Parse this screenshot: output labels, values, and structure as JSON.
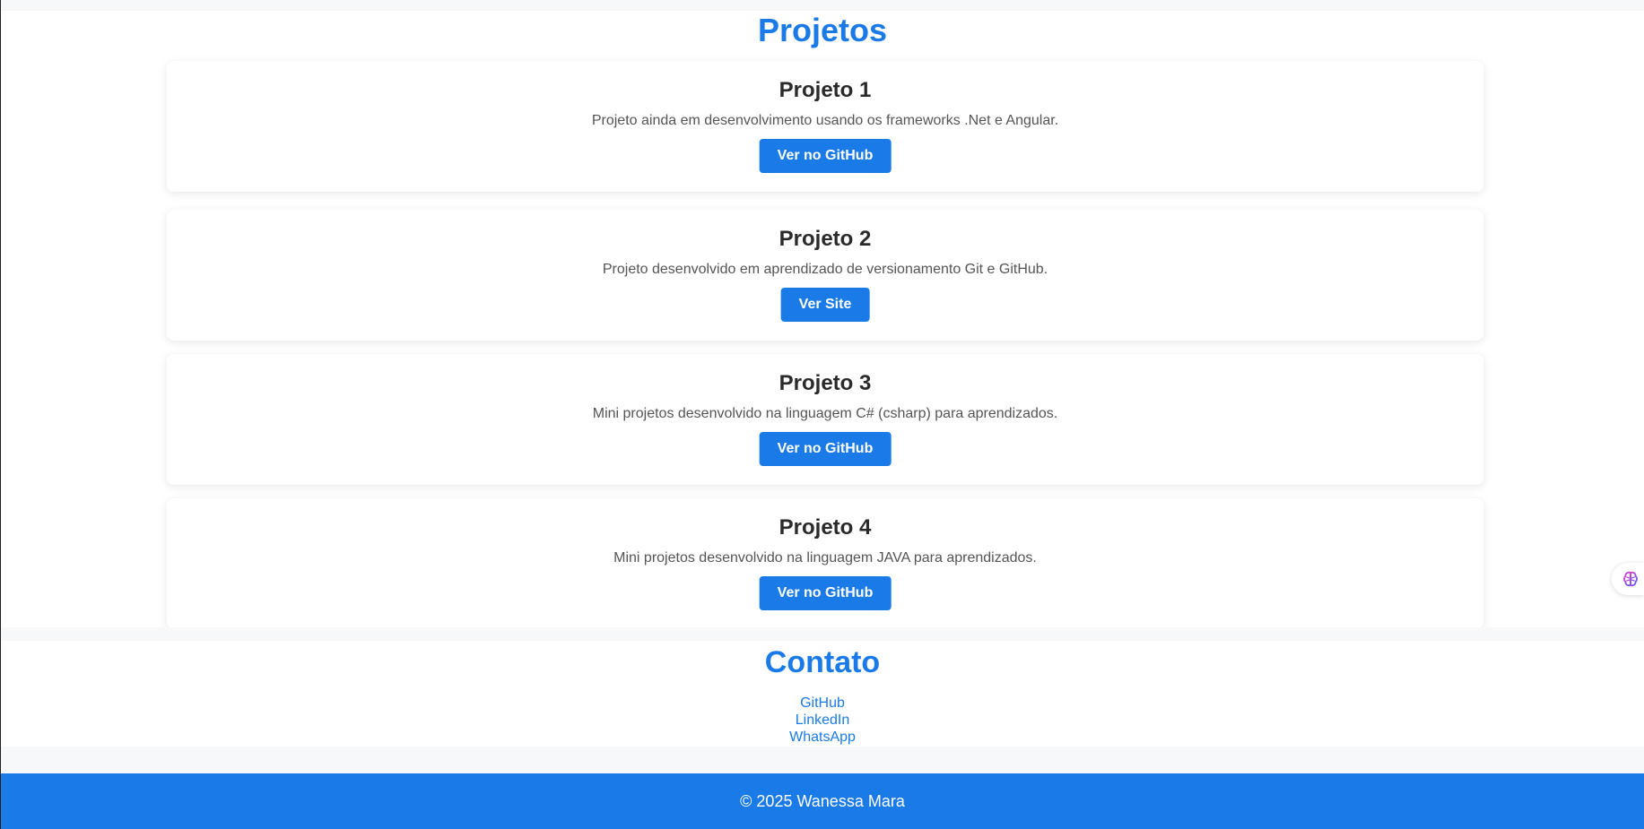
{
  "projects": {
    "title": "Projetos",
    "items": [
      {
        "title": "Projeto 1",
        "description": "Projeto ainda em desenvolvimento usando os frameworks .Net e Angular.",
        "button_label": "Ver no GitHub"
      },
      {
        "title": "Projeto 2",
        "description": "Projeto desenvolvido em aprendizado de versionamento Git e GitHub.",
        "button_label": "Ver Site"
      },
      {
        "title": "Projeto 3",
        "description": "Mini projetos desenvolvido na linguagem C# (csharp) para aprendizados.",
        "button_label": "Ver no GitHub"
      },
      {
        "title": "Projeto 4",
        "description": "Mini projetos desenvolvido na linguagem JAVA para aprendizados.",
        "button_label": "Ver no GitHub"
      }
    ]
  },
  "contact": {
    "title": "Contato",
    "links": [
      {
        "label": "GitHub"
      },
      {
        "label": "LinkedIn"
      },
      {
        "label": "WhatsApp"
      }
    ]
  },
  "footer": {
    "text": "© 2025 Wanessa Mara"
  },
  "extension_widget": {
    "icon": "brain-icon"
  },
  "colors": {
    "accent": "#1a7ae8",
    "heading": "#2a2a2a",
    "body_text": "#555555",
    "background": "#ffffff",
    "band": "#f7f8fa"
  }
}
